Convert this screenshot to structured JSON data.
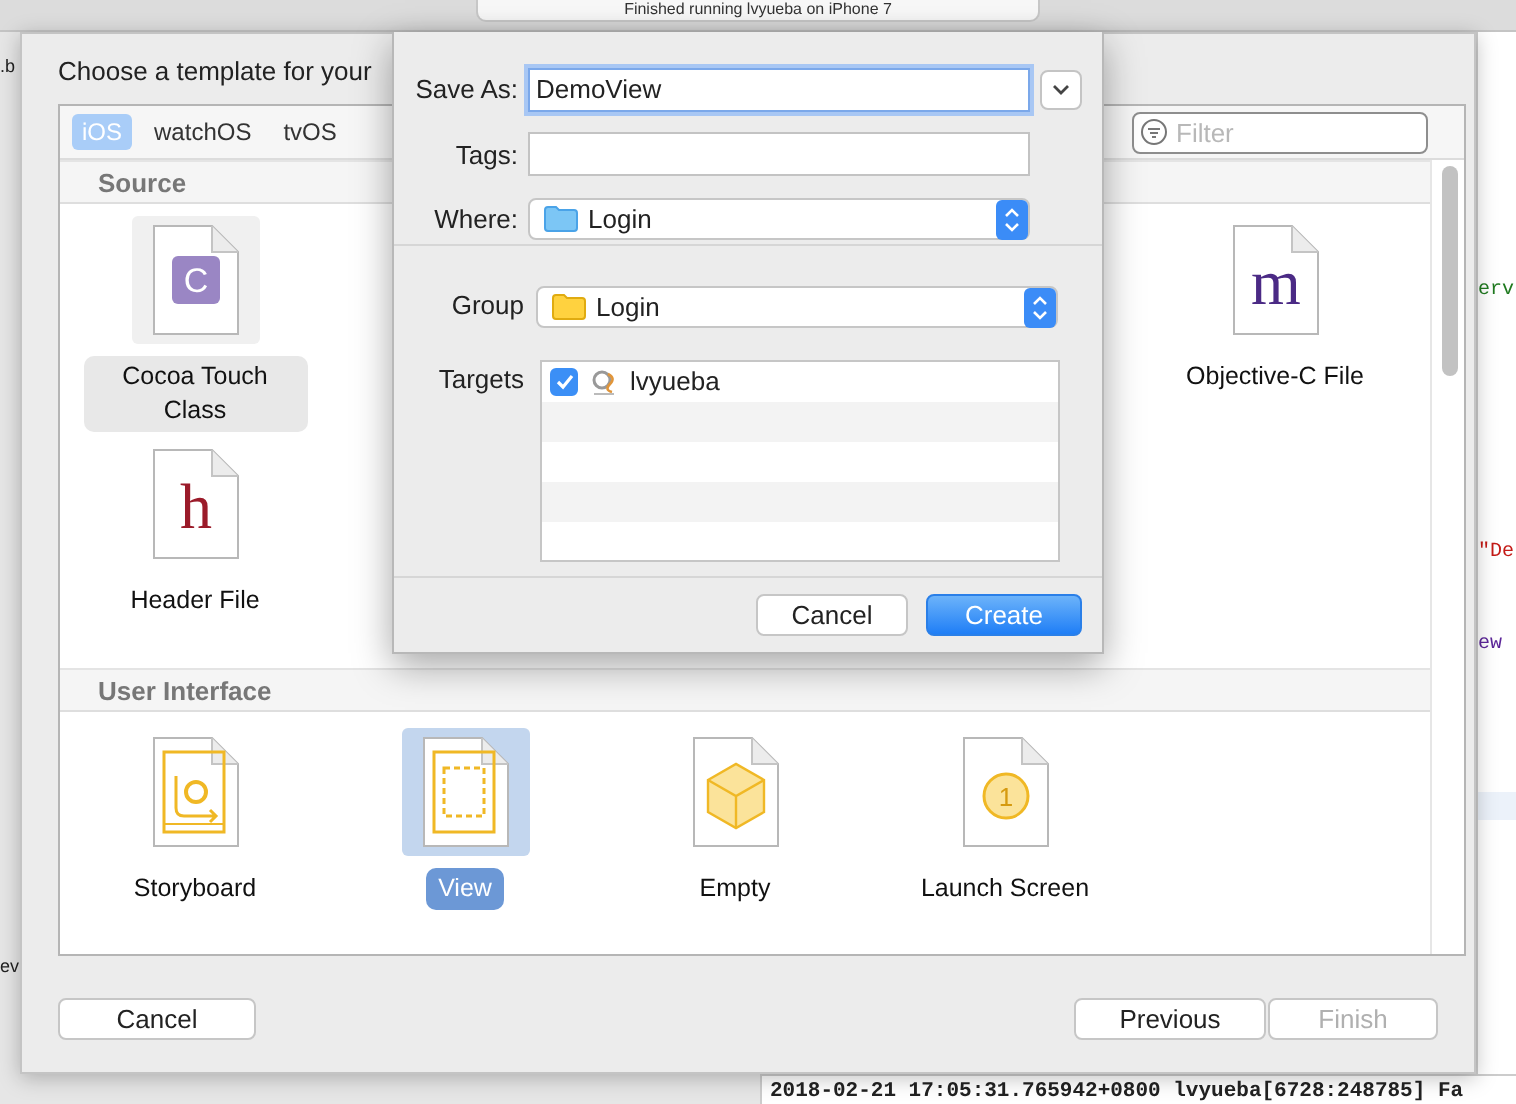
{
  "background": {
    "activity": "Finished running lvyueba on iPhone 7",
    "left_fragments": [
      ".b",
      "ev"
    ],
    "code_fragments": [
      {
        "text": "erv",
        "color": "#1f7a1f"
      },
      {
        "text": "\"De",
        "color": "#c41a16"
      },
      {
        "text": "ew",
        "color": "#5c2699"
      }
    ],
    "console": [
      "2018-02-21 17:05:31.765942+0800 lvyueba[6728:248785] Fa"
    ]
  },
  "template_sheet": {
    "title": "Choose a template for your",
    "platform_tabs": [
      {
        "label": "iOS",
        "selected": true
      },
      {
        "label": "watchOS",
        "selected": false
      },
      {
        "label": "tvOS",
        "selected": false
      }
    ],
    "filter": {
      "placeholder": "Filter"
    },
    "sections": [
      {
        "title": "Source",
        "templates": [
          {
            "label": "Cocoa Touch Class",
            "kind": "badge",
            "glyph": "C",
            "selected": false,
            "highlighted": true
          },
          {
            "label": "Objective-C File",
            "kind": "letter",
            "glyph": "m",
            "color": "#4b2a85",
            "selected": false,
            "highlighted": false
          },
          {
            "label": "Header File",
            "kind": "letter",
            "glyph": "h",
            "color": "#9b1b2a",
            "selected": false,
            "highlighted": false
          }
        ]
      },
      {
        "title": "User Interface",
        "templates": [
          {
            "label": "Storyboard",
            "kind": "storyboard",
            "selected": false,
            "highlighted": false
          },
          {
            "label": "View",
            "kind": "view",
            "selected": true,
            "highlighted": false
          },
          {
            "label": "Empty",
            "kind": "cube",
            "selected": false,
            "highlighted": false
          },
          {
            "label": "Launch Screen",
            "kind": "launch",
            "glyph": "1",
            "selected": false,
            "highlighted": false
          }
        ]
      }
    ],
    "buttons": [
      {
        "label": "Cancel",
        "disabled": false
      },
      {
        "label": "Previous",
        "disabled": false
      },
      {
        "label": "Finish",
        "disabled": true
      }
    ]
  },
  "save_panel": {
    "save_as": {
      "label": "Save As:",
      "value": "DemoView"
    },
    "tags": {
      "label": "Tags:"
    },
    "where": {
      "label": "Where:",
      "value": "Login"
    },
    "group": {
      "label": "Group",
      "value": "Login"
    },
    "targets": {
      "label": "Targets",
      "items": [
        {
          "name": "lvyueba",
          "checked": true
        }
      ]
    },
    "buttons": [
      {
        "label": "Cancel",
        "default": false
      },
      {
        "label": "Create",
        "default": true
      }
    ]
  }
}
